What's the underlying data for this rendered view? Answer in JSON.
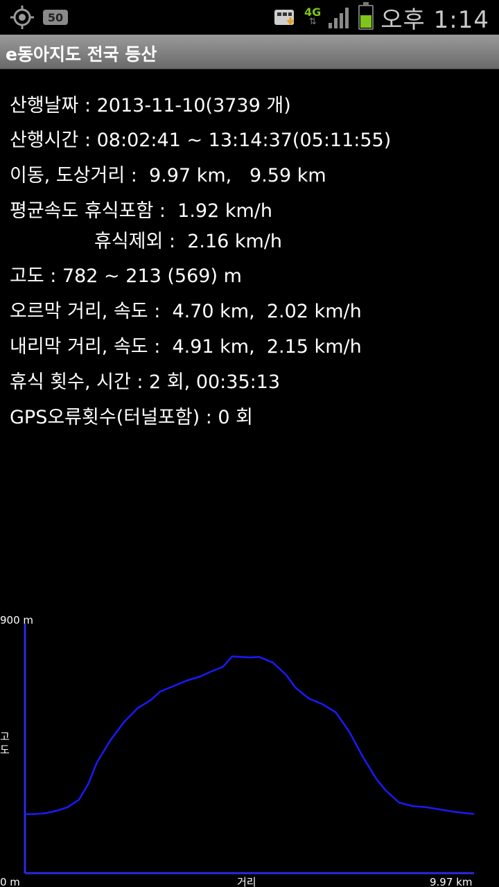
{
  "status_bar": {
    "time": "오후 1:14",
    "icons": [
      "gps-icon",
      "badge-50-icon",
      "screenshot-download-icon",
      "network-4g-icon",
      "signal-icon",
      "battery-icon"
    ],
    "badge": "50",
    "network": "4G",
    "battery_level": 0.55,
    "colors": {
      "accent": "#7ec41a"
    }
  },
  "app": {
    "title": "e동아지도 전국 등산"
  },
  "stats": {
    "date": "산행날짜 : 2013-11-10(3739 개)",
    "time": "산행시간 : 08:02:41 ~ 13:14:37(05:11:55)",
    "distance": "이동, 도상거리 :  9.97 km,   9.59 km",
    "avg_speed_incl": "평균속도 휴식포함 :  1.92 km/h",
    "avg_speed_excl": "휴식제외 :  2.16 km/h",
    "altitude": "고도 : 782 ~ 213 (569) m",
    "uphill": "오르막 거리, 속도 :  4.70 km,  2.02 km/h",
    "downhill": "내리막 거리, 속도 :  4.91 km,  2.15 km/h",
    "rest": "휴식 횟수, 시간 : 2 회, 00:35:13",
    "gps_errors": "GPS오류횟수(터널포함) : 0 회"
  },
  "chart_data": {
    "type": "line",
    "title": "",
    "xlabel": "거리",
    "ylabel": "고도",
    "xlim": [
      0,
      9.97
    ],
    "ylim": [
      0,
      900
    ],
    "x_tick_labels": [
      "0 m",
      "9.97 km"
    ],
    "y_tick_labels": [
      "0 m",
      "900 m"
    ],
    "grid": false,
    "line_color": "#1a1aff",
    "axis_color": "#2a2ae0",
    "series": [
      {
        "x": [
          0,
          0.2,
          0.45,
          0.7,
          0.95,
          1.2,
          1.4,
          1.6,
          1.9,
          2.2,
          2.5,
          2.8,
          3.0,
          3.3,
          3.6,
          3.9,
          4.1,
          4.4,
          4.6,
          4.8,
          5.0,
          5.2,
          5.5,
          5.8,
          6.0,
          6.3,
          6.6,
          6.9,
          7.2,
          7.5,
          7.8,
          8.0,
          8.3,
          8.6,
          8.9,
          9.2,
          9.5,
          9.97
        ],
        "y": [
          213,
          213,
          216,
          225,
          238,
          265,
          320,
          400,
          480,
          545,
          595,
          625,
          655,
          675,
          695,
          710,
          725,
          745,
          782,
          780,
          778,
          780,
          760,
          715,
          670,
          630,
          610,
          580,
          510,
          420,
          340,
          300,
          255,
          242,
          238,
          230,
          222,
          213
        ]
      }
    ]
  }
}
